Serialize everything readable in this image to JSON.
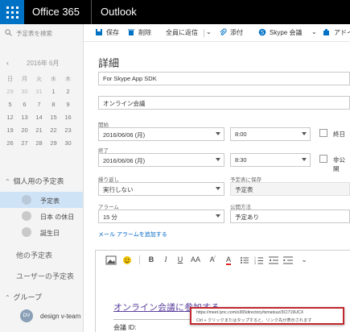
{
  "topbar": {
    "app_title": "Office 365",
    "module": "Outlook"
  },
  "left": {
    "search_placeholder": "予定表を検索",
    "mini_calendar": {
      "title": "2016年 6月",
      "weekdays": [
        "日",
        "月",
        "火",
        "水",
        "木"
      ],
      "weeks": [
        [
          "29",
          "30",
          "31",
          "1",
          "2"
        ],
        [
          "5",
          "6",
          "7",
          "8",
          "9"
        ],
        [
          "12",
          "13",
          "14",
          "15",
          "16"
        ],
        [
          "19",
          "20",
          "21",
          "22",
          "23"
        ],
        [
          "26",
          "27",
          "28",
          "29",
          "30"
        ]
      ]
    },
    "personal_header": "個人用の予定表",
    "calendars": [
      {
        "label": "予定表",
        "selected": true
      },
      {
        "label": "日本 の休日",
        "selected": false
      },
      {
        "label": "誕生日",
        "selected": false
      }
    ],
    "other_calendars": "他の予定表",
    "user_calendars": "ユーザーの予定表",
    "group_header": "グループ",
    "groups": [
      {
        "initials": "DV",
        "label": "design v-team"
      }
    ]
  },
  "commands": {
    "save": "保存",
    "delete": "削除",
    "reply_all": "全員に返信",
    "attach": "添付",
    "skype": "Skype 会議",
    "more": "アドイ"
  },
  "form": {
    "title": "詳細",
    "subject": "For Skype App SDK",
    "location": "オンライン会議",
    "start_label": "開始",
    "start_date": "2016/06/06 (月)",
    "start_time": "8:00",
    "allday_label": "終日",
    "end_label": "終了",
    "end_date": "2016/06/06 (月)",
    "end_time": "8:30",
    "private_label": "非公開",
    "repeat_label": "繰り返し",
    "repeat_value": "実行しない",
    "save_to_label": "予定表に保存",
    "save_to_value": "予定表",
    "alarm_label": "アラーム",
    "alarm_value": "15 分",
    "show_as_label": "公開方法",
    "show_as_value": "予定あり",
    "add_email_alarm": "メール アラームを追加する"
  },
  "editor": {
    "meeting_link": "オンライン会議に参加する",
    "tooltip_url": "https://meet.lync.com/o365directory/tsmatsuz/3CI719UCX",
    "tooltip_hint": "Ctrl + クリックまたはタップすると、リンク先が表示されます",
    "conference_id": "会議 ID:"
  },
  "colors": {
    "brand": "#0072c6",
    "link": "#0066c5",
    "highlight": "#c0282f"
  }
}
